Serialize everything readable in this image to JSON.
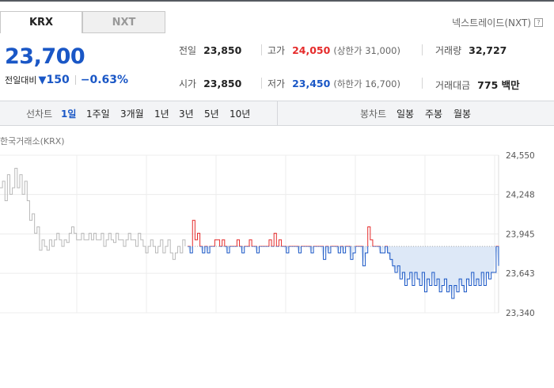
{
  "tabs": {
    "krx": "KRX",
    "nxt": "NXT"
  },
  "nxt_link": {
    "label": "넥스트레이드(NXT)",
    "icon": "?"
  },
  "price": {
    "current": "23,700",
    "prev_label": "전일대비",
    "change_symbol": "▼",
    "change": "150",
    "change_pct": "−0.63%"
  },
  "stats": {
    "prev_close": {
      "label": "전일",
      "value": "23,850"
    },
    "high": {
      "label": "고가",
      "value": "24,050",
      "sub": "(상한가 31,000)"
    },
    "volume": {
      "label": "거래량",
      "value": "32,727"
    },
    "open": {
      "label": "시가",
      "value": "23,850"
    },
    "low": {
      "label": "저가",
      "value": "23,450",
      "sub": "(하한가 16,700)"
    },
    "amount": {
      "label": "거래대금",
      "value": "775 백만"
    }
  },
  "toolbar": {
    "line_label": "선차트",
    "periods": [
      "1일",
      "1주일",
      "3개월",
      "1년",
      "3년",
      "5년",
      "10년"
    ],
    "active_period": "1일",
    "candle_label": "봉차트",
    "candles": [
      "일봉",
      "주봉",
      "월봉"
    ]
  },
  "exchange_label": "한국거래소(KRX)",
  "colors": {
    "up": "#e52b2b",
    "down": "#1a57c6",
    "pre": "#b9b9b9",
    "fill": "#dde8f7",
    "grid": "#ececec"
  },
  "chart_data": {
    "type": "line",
    "title": "",
    "xlabel": "",
    "ylabel": "",
    "ylim": [
      23340,
      24550
    ],
    "yticks": [
      "24,550",
      "24,248",
      "23,945",
      "23,643",
      "23,340"
    ],
    "ytick_values": [
      24550,
      24248,
      23945,
      23643,
      23340
    ],
    "baseline": 23850,
    "series": [
      {
        "segment": "pre-market",
        "x": [
          0,
          1,
          2,
          3,
          4,
          5,
          6,
          7,
          8,
          9,
          10,
          11,
          12,
          13,
          14,
          15,
          16,
          17,
          18,
          19,
          20,
          21,
          22,
          23,
          24,
          25,
          26,
          27,
          28,
          29,
          30,
          31,
          32,
          33,
          34,
          35,
          36,
          37,
          38,
          39,
          40,
          41,
          42,
          43,
          44,
          45,
          46,
          47,
          48,
          49,
          50,
          51,
          52,
          53,
          54,
          55,
          56,
          57,
          58,
          59,
          60,
          61,
          62,
          63,
          64,
          65,
          66,
          67,
          68,
          69,
          70,
          71,
          72,
          73,
          74,
          75
        ],
        "y": [
          24300,
          24350,
          24200,
          24400,
          24250,
          24300,
          24450,
          24300,
          24400,
          24250,
          24350,
          24200,
          24050,
          24100,
          23950,
          24000,
          23820,
          23900,
          23850,
          23820,
          23900,
          23850,
          23900,
          23950,
          23900,
          23850,
          23900,
          23880,
          23950,
          24000,
          23950,
          23900,
          23900,
          23950,
          23900,
          23900,
          23950,
          23900,
          23950,
          23900,
          23900,
          23950,
          23850,
          23900,
          23950,
          23900,
          23880,
          23950,
          23900,
          23900,
          23850,
          23900,
          23950,
          23900,
          23900,
          23850,
          23950,
          23900,
          23850,
          23800,
          23850,
          23900,
          23850,
          23800,
          23850,
          23900,
          23800,
          23850,
          23900,
          23800,
          23750,
          23800,
          23850,
          23800,
          23900,
          23850
        ]
      },
      {
        "segment": "regular",
        "x": [
          76,
          77,
          78,
          79,
          80,
          81,
          82,
          83,
          84,
          85,
          86,
          87,
          88,
          89,
          90,
          91,
          92,
          93,
          94,
          95,
          96,
          97,
          98,
          99,
          100,
          101,
          102,
          103,
          104,
          105,
          106,
          107,
          108,
          109,
          110,
          111,
          112,
          113,
          114,
          115,
          116,
          117,
          118,
          119,
          120,
          121,
          122,
          123,
          124,
          125,
          126,
          127,
          128,
          129,
          130,
          131,
          132,
          133,
          134,
          135,
          136,
          137,
          138,
          139,
          140,
          141,
          142,
          143,
          144,
          145,
          146,
          147,
          148,
          149,
          150,
          151,
          152,
          153,
          154,
          155,
          156,
          157,
          158,
          159,
          160,
          161,
          162,
          163,
          164,
          165,
          166,
          167,
          168,
          169,
          170,
          171,
          172,
          173,
          174,
          175,
          176,
          177,
          178,
          179,
          180,
          181,
          182,
          183,
          184,
          185,
          186,
          187,
          188,
          189,
          190,
          191,
          192,
          193,
          194,
          195,
          196,
          197,
          198,
          199,
          200,
          201,
          202
        ],
        "y": [
          23850,
          23800,
          24050,
          23900,
          23950,
          23850,
          23800,
          23850,
          23800,
          23850,
          23850,
          23900,
          23900,
          23850,
          23900,
          23850,
          23800,
          23850,
          23850,
          23850,
          23900,
          23850,
          23800,
          23850,
          23850,
          23900,
          23850,
          23850,
          23800,
          23850,
          23850,
          23850,
          23850,
          23900,
          23850,
          23950,
          23850,
          23900,
          23850,
          23850,
          23800,
          23850,
          23850,
          23850,
          23850,
          23800,
          23850,
          23850,
          23850,
          23850,
          23800,
          23850,
          23850,
          23850,
          23850,
          23750,
          23850,
          23800,
          23850,
          23850,
          23850,
          23800,
          23850,
          23800,
          23850,
          23850,
          23750,
          23800,
          23850,
          23850,
          23850,
          23700,
          23800,
          24000,
          23900,
          23850,
          23850,
          23850,
          23800,
          23800,
          23850,
          23800,
          23750,
          23700,
          23650,
          23700,
          23600,
          23650,
          23550,
          23600,
          23650,
          23550,
          23650,
          23600,
          23550,
          23650,
          23500,
          23600,
          23550,
          23650,
          23550,
          23600,
          23500,
          23550,
          23600,
          23500,
          23550,
          23450,
          23550,
          23500,
          23600,
          23550,
          23500,
          23600,
          23550,
          23650,
          23550,
          23600,
          23550,
          23650,
          23550,
          23650,
          23600,
          23650,
          23650,
          23850,
          23700
        ]
      }
    ]
  }
}
